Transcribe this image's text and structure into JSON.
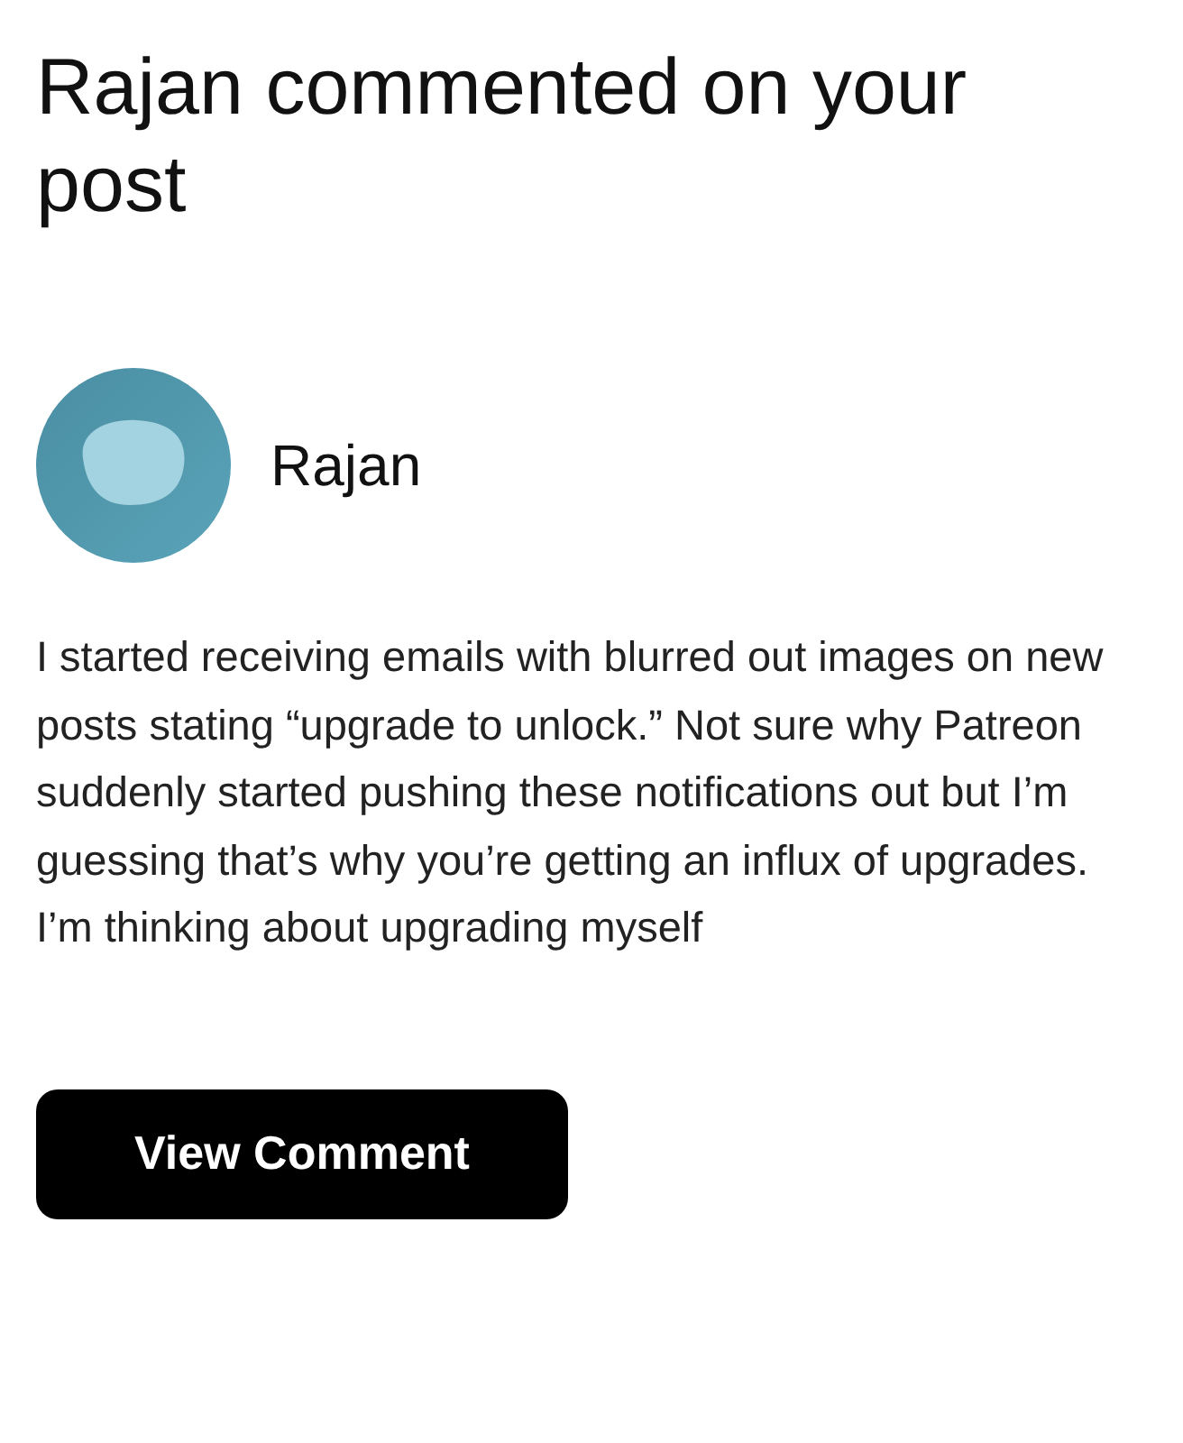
{
  "title": "Rajan commented on your post",
  "commenter": {
    "name": "Rajan"
  },
  "comment": "I started receiving emails with blurred out images on new posts stating “upgrade to unlock.” Not sure why Patreon suddenly started pushing these notifications out but I’m guessing that’s why you’re getting an influx of upgrades. I’m thinking about upgrading myself",
  "button": "View Comment"
}
